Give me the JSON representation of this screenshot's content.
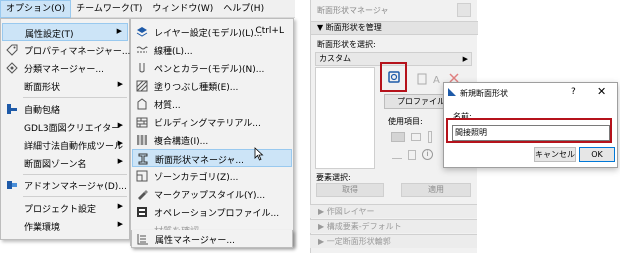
{
  "menubar": {
    "items": [
      "オプション(O)",
      "チームワーク(T)",
      "ウィンドウ(W)",
      "ヘルプ(H)"
    ]
  },
  "options_menu": {
    "items": [
      {
        "label": "属性設定(T)",
        "submenu": true,
        "highlighted": true,
        "icon": "none"
      },
      {
        "label": "プロパティマネージャー...",
        "submenu": false,
        "icon": "tag-icon"
      },
      {
        "label": "分類マネージャー...",
        "submenu": false,
        "icon": "classification-icon"
      },
      {
        "label": "断面形状",
        "submenu": true,
        "icon": "none"
      },
      {
        "label": "自動包絡",
        "submenu": false,
        "icon": "auto-merge-icon"
      },
      {
        "label": "GDL3面図クリエイター",
        "submenu": true,
        "icon": "none"
      },
      {
        "label": "詳細寸法自動作成ツール",
        "submenu": true,
        "icon": "none"
      },
      {
        "label": "断面図ゾーン名",
        "submenu": true,
        "icon": "none"
      },
      {
        "label": "アドオンマネージャ(D)...",
        "submenu": false,
        "icon": "addon-icon"
      },
      {
        "label": "プロジェクト設定",
        "submenu": true,
        "icon": "none"
      },
      {
        "label": "作業環境",
        "submenu": true,
        "icon": "none"
      }
    ]
  },
  "attributes_submenu": {
    "items": [
      {
        "label": "レイヤー設定(モデル)(L)...",
        "shortcut": "Ctrl+L",
        "icon": "layer-icon"
      },
      {
        "label": "線種(L)...",
        "icon": "line-type-icon"
      },
      {
        "label": "ペンとカラー(モデル)(N)...",
        "icon": "pen-icon"
      },
      {
        "label": "塗りつぶし種類(E)...",
        "icon": "fill-icon"
      },
      {
        "label": "材質...",
        "icon": "surface-icon"
      },
      {
        "label": "ビルディングマテリアル...",
        "icon": "building-material-icon"
      },
      {
        "label": "複合構造(I)...",
        "icon": "composite-icon"
      },
      {
        "label": "断面形状マネージャ...",
        "icon": "profile-manager-icon",
        "highlighted": true
      },
      {
        "label": "ゾーンカテゴリ(Z)...",
        "icon": "zone-icon"
      },
      {
        "label": "マークアップスタイル(Y)...",
        "icon": "markup-icon"
      },
      {
        "label": "オペレーションプロファイル...",
        "icon": "operation-profile-icon"
      },
      {
        "label": "材質を確認...",
        "icon": "none",
        "disabled": true
      },
      {
        "label": "属性マネージャー...",
        "icon": "attribute-manager-icon"
      }
    ]
  },
  "panel": {
    "title": "断面形状マネージャ",
    "section_manage": "▼ 断面形状を管理",
    "select_label": "断面形状を選択:",
    "select_value": "カスタム",
    "profile_button": "プロファイルの編",
    "use_label": "使用項目:",
    "element_select_label": "要素選択:",
    "get_button": "取得",
    "apply_button": "適用",
    "folds": [
      "▶ 作図レイヤー",
      "▶ 構成要素-デフォルト",
      "▶ 一定断面形状輪郭"
    ]
  },
  "dialog": {
    "title": "新規断面形状",
    "help": "?",
    "close": "✕",
    "name_label": "名前:",
    "name_value": "間接照明",
    "cancel": "キャンセル",
    "ok": "OK"
  },
  "colors": {
    "highlight": "#cce4f7",
    "annotation_red": "#b5121b",
    "ok_border": "#0078d7"
  }
}
